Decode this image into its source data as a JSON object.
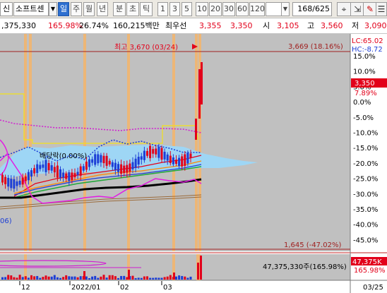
{
  "toolbar": {
    "code_label": "신",
    "stock_name": "소프트센",
    "period_tabs": [
      "일",
      "주",
      "월",
      "년",
      "분",
      "초",
      "틱"
    ],
    "active_period": "일",
    "intervals": [
      "1",
      "3",
      "5",
      "10",
      "20",
      "30",
      "60",
      "120"
    ],
    "record_count": "168/625"
  },
  "quote": {
    "volume_prev": ",375,330",
    "change_pct": "165.98%",
    "turnover": "26.74%",
    "amount": "160,215백만",
    "best_label": "최우선",
    "best_ask": "3,355",
    "best_bid": "3,350",
    "open_label": "시",
    "open": "3,105",
    "high_label": "고",
    "high": "3,560",
    "low_label": "저",
    "low": "3,090"
  },
  "price_chart": {
    "max_annotation": "최고 3,670 (03/24)",
    "max_line_label": "3,669 (18.16%)",
    "min_line_label": "1,645 (-47.02%)",
    "dividend_label": "배당락(0.00%)",
    "left_fragment": "06)",
    "lc_label": "LC:65.02",
    "hc_label": "HC:-8.72",
    "current_price": "3,350",
    "current_pct": "7.89%",
    "pct_ticks": [
      "15.0%",
      "10.0%",
      "5.0%",
      "0.0%",
      "-5.0%",
      "-10.0%",
      "-15.0%",
      "-20.0%",
      "-25.0%",
      "-30.0%",
      "-35.0%",
      "-40.0%",
      "-45.0%"
    ]
  },
  "volume_chart": {
    "volume_annotation": "47,375,330주(165.98%)",
    "last_volume": "47,375K",
    "last_pct": "165.98%"
  },
  "date_axis": {
    "labels": [
      "12",
      "2022/01",
      "02",
      "03"
    ],
    "end_label": "03/25"
  },
  "colors": {
    "up": "#e2001a",
    "down": "#1c3ed6",
    "chart_bg": "#c0c0c0",
    "highlight_band": "#f5b56a",
    "cloud": "#9ed6f5",
    "accent": "#2d6fd0"
  }
}
